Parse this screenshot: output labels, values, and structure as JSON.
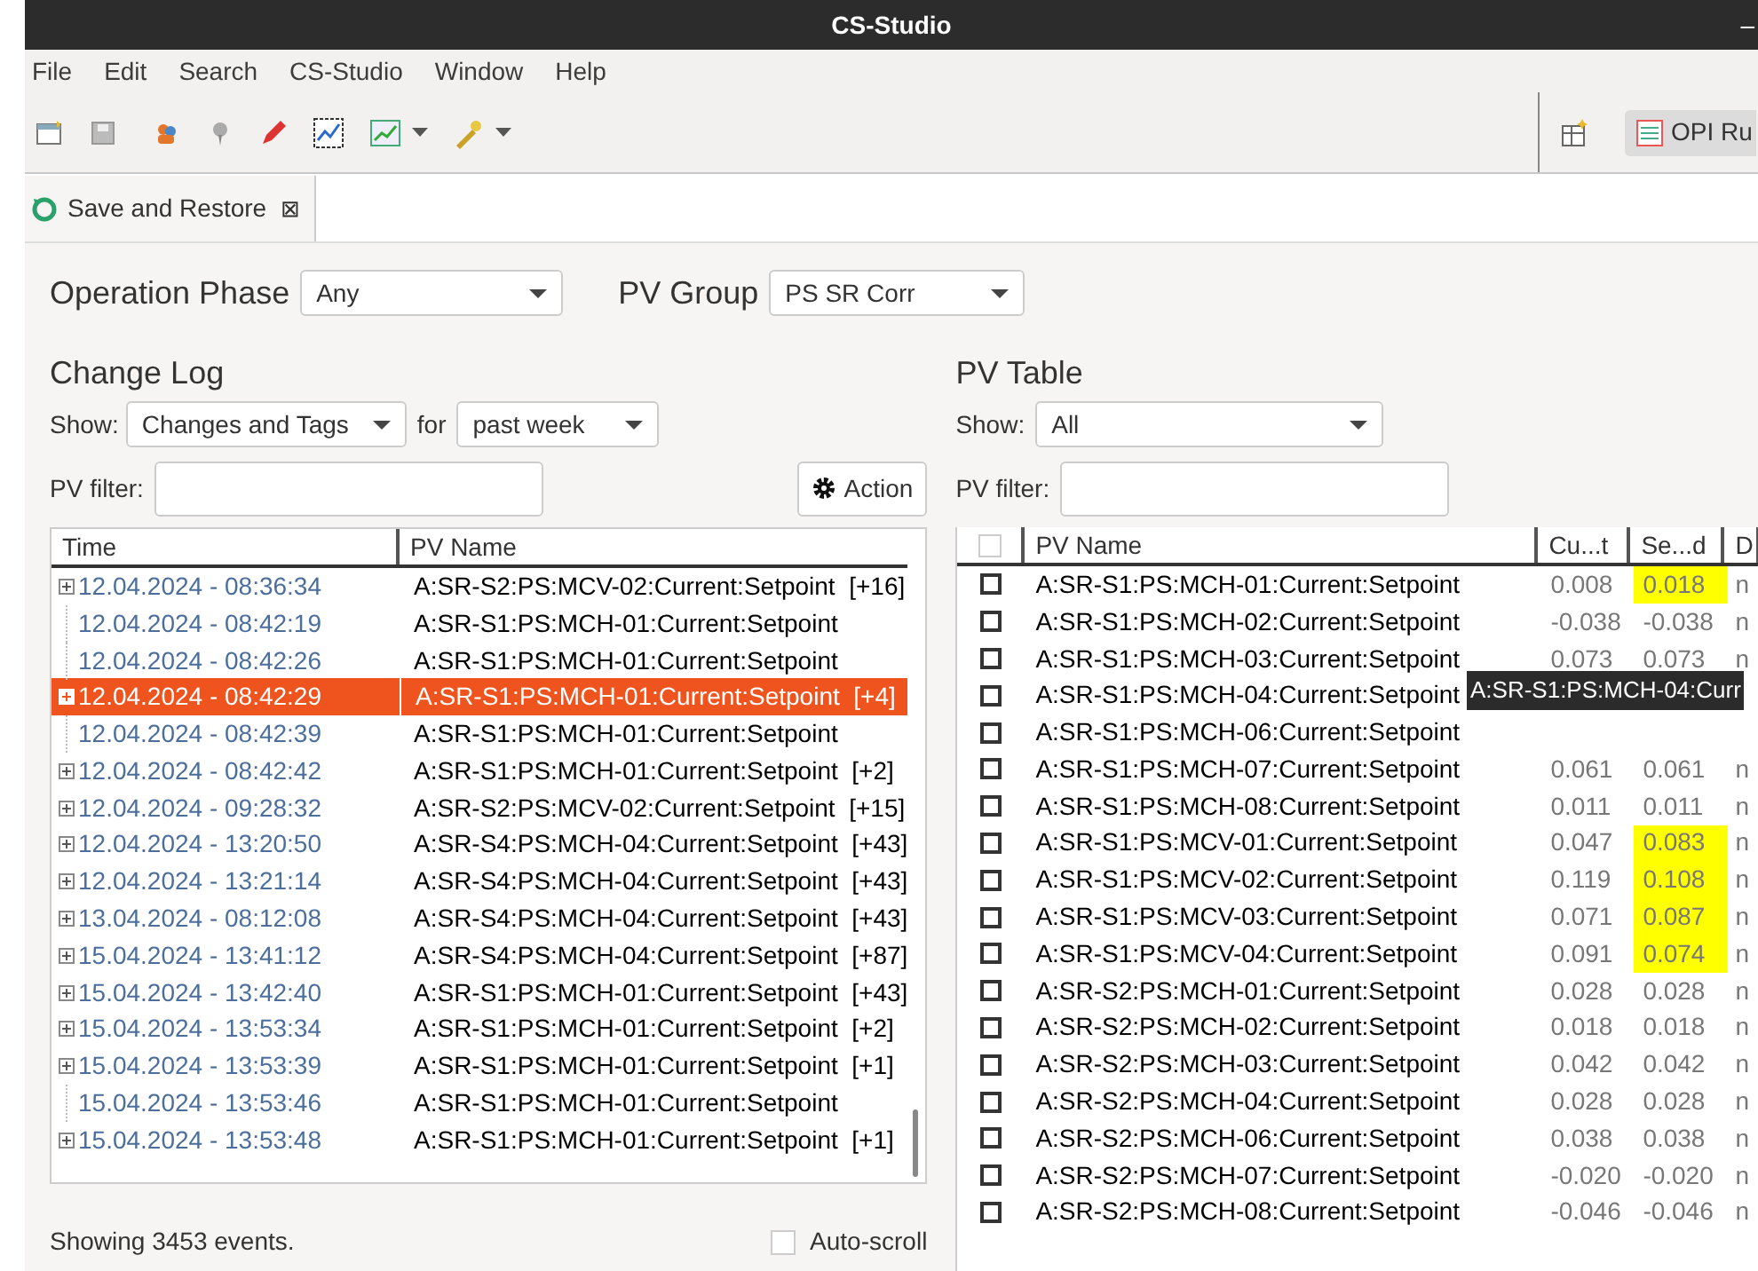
{
  "window": {
    "title": "CS-Studio",
    "control": "–"
  },
  "menu": [
    "File",
    "Edit",
    "Search",
    "CS-Studio",
    "Window",
    "Help"
  ],
  "toolbar": {
    "perspective_button": "OPI Ru"
  },
  "tabs": [
    {
      "label": "Save and Restore",
      "close": "⊠",
      "selected": true
    }
  ],
  "filters": {
    "operation_phase": {
      "label": "Operation Phase",
      "value": "Any"
    },
    "pv_group": {
      "label": "PV Group",
      "value": "PS SR Corr"
    }
  },
  "change_log": {
    "title": "Change Log",
    "show_label": "Show:",
    "show_value": "Changes and Tags",
    "for_label": "for",
    "for_value": "past week",
    "filter_label": "PV filter:",
    "action_button": "Action",
    "columns": [
      "Time",
      "PV Name"
    ],
    "rows": [
      {
        "time": "12.04.2024 - 08:36:34",
        "pv": "A:SR-S2:PS:MCV-02:Current:Setpoint",
        "count": "[+16]",
        "expandable": true,
        "selected": false
      },
      {
        "time": "12.04.2024 - 08:42:19",
        "pv": "A:SR-S1:PS:MCH-01:Current:Setpoint",
        "expandable": false,
        "selected": false
      },
      {
        "time": "12.04.2024 - 08:42:26",
        "pv": "A:SR-S1:PS:MCH-01:Current:Setpoint",
        "expandable": false,
        "selected": false
      },
      {
        "time": "12.04.2024 - 08:42:29",
        "pv": "A:SR-S1:PS:MCH-01:Current:Setpoint",
        "count": "[+4]",
        "expandable": true,
        "selected": true
      },
      {
        "time": "12.04.2024 - 08:42:39",
        "pv": "A:SR-S1:PS:MCH-01:Current:Setpoint",
        "expandable": false,
        "selected": false
      },
      {
        "time": "12.04.2024 - 08:42:42",
        "pv": "A:SR-S1:PS:MCH-01:Current:Setpoint",
        "count": "[+2]",
        "expandable": true,
        "selected": false
      },
      {
        "time": "12.04.2024 - 09:28:32",
        "pv": "A:SR-S2:PS:MCV-02:Current:Setpoint",
        "count": "[+15]",
        "expandable": true,
        "selected": false
      },
      {
        "time": "12.04.2024 - 13:20:50",
        "pv": "A:SR-S4:PS:MCH-04:Current:Setpoint",
        "count": "[+43]",
        "expandable": true,
        "selected": false
      },
      {
        "time": "12.04.2024 - 13:21:14",
        "pv": "A:SR-S4:PS:MCH-04:Current:Setpoint",
        "count": "[+43]",
        "expandable": true,
        "selected": false
      },
      {
        "time": "13.04.2024 - 08:12:08",
        "pv": "A:SR-S4:PS:MCH-04:Current:Setpoint",
        "count": "[+43]",
        "expandable": true,
        "selected": false
      },
      {
        "time": "15.04.2024 - 13:41:12",
        "pv": "A:SR-S4:PS:MCH-04:Current:Setpoint",
        "count": "[+87]",
        "expandable": true,
        "selected": false
      },
      {
        "time": "15.04.2024 - 13:42:40",
        "pv": "A:SR-S1:PS:MCH-01:Current:Setpoint",
        "count": "[+43]",
        "expandable": true,
        "selected": false
      },
      {
        "time": "15.04.2024 - 13:53:34",
        "pv": "A:SR-S1:PS:MCH-01:Current:Setpoint",
        "count": "[+2]",
        "expandable": true,
        "selected": false
      },
      {
        "time": "15.04.2024 - 13:53:39",
        "pv": "A:SR-S1:PS:MCH-01:Current:Setpoint",
        "count": "[+1]",
        "expandable": true,
        "selected": false
      },
      {
        "time": "15.04.2024 - 13:53:46",
        "pv": "A:SR-S1:PS:MCH-01:Current:Setpoint",
        "expandable": false,
        "selected": false
      },
      {
        "time": "15.04.2024 - 13:53:48",
        "pv": "A:SR-S1:PS:MCH-01:Current:Setpoint",
        "count": "[+1]",
        "expandable": true,
        "selected": false
      }
    ],
    "status": "Showing 3453 events.",
    "auto_scroll": {
      "label": "Auto-scroll",
      "checked": false
    }
  },
  "pv_table": {
    "title": "PV Table",
    "show_label": "Show:",
    "show_value": "All",
    "filter_label": "PV filter:",
    "select_all_checked": false,
    "columns": [
      "PV Name",
      "Cu...t",
      "Se...d",
      "D"
    ],
    "rows": [
      {
        "name": "A:SR-S1:PS:MCH-01:Current:Setpoint",
        "current": "0.008",
        "saved": "0.018",
        "changed": true,
        "column_4": "n",
        "checked": false
      },
      {
        "name": "A:SR-S1:PS:MCH-02:Current:Setpoint",
        "current": "-0.038",
        "saved": "-0.038",
        "changed": false,
        "column_4": "n",
        "checked": false
      },
      {
        "name": "A:SR-S1:PS:MCH-03:Current:Setpoint",
        "current": "0.073",
        "saved": "0.073",
        "changed": false,
        "column_4": "n",
        "checked": false
      },
      {
        "name": "A:SR-S1:PS:MCH-04:Current:Setpoint",
        "checked": false
      },
      {
        "name": "A:SR-S1:PS:MCH-06:Current:Setpoint",
        "checked": false
      },
      {
        "name": "A:SR-S1:PS:MCH-07:Current:Setpoint",
        "current": "0.061",
        "saved": "0.061",
        "changed": false,
        "column_4": "n",
        "checked": false
      },
      {
        "name": "A:SR-S1:PS:MCH-08:Current:Setpoint",
        "current": "0.011",
        "saved": "0.011",
        "changed": false,
        "column_4": "n",
        "checked": false
      },
      {
        "name": "A:SR-S1:PS:MCV-01:Current:Setpoint",
        "current": "0.047",
        "saved": "0.083",
        "changed": true,
        "column_4": "n",
        "checked": false
      },
      {
        "name": "A:SR-S1:PS:MCV-02:Current:Setpoint",
        "current": "0.119",
        "saved": "0.108",
        "changed": true,
        "column_4": "n",
        "checked": false
      },
      {
        "name": "A:SR-S1:PS:MCV-03:Current:Setpoint",
        "current": "0.071",
        "saved": "0.087",
        "changed": true,
        "column_4": "n",
        "checked": false
      },
      {
        "name": "A:SR-S1:PS:MCV-04:Current:Setpoint",
        "current": "0.091",
        "saved": "0.074",
        "changed": true,
        "column_4": "n",
        "checked": false
      },
      {
        "name": "A:SR-S2:PS:MCH-01:Current:Setpoint",
        "current": "0.028",
        "saved": "0.028",
        "changed": false,
        "column_4": "n",
        "checked": false
      },
      {
        "name": "A:SR-S2:PS:MCH-02:Current:Setpoint",
        "current": "0.018",
        "saved": "0.018",
        "changed": false,
        "column_4": "n",
        "checked": false
      },
      {
        "name": "A:SR-S2:PS:MCH-03:Current:Setpoint",
        "current": "0.042",
        "saved": "0.042",
        "changed": false,
        "column_4": "n",
        "checked": false
      },
      {
        "name": "A:SR-S2:PS:MCH-04:Current:Setpoint",
        "current": "0.028",
        "saved": "0.028",
        "changed": false,
        "column_4": "n",
        "checked": false
      },
      {
        "name": "A:SR-S2:PS:MCH-06:Current:Setpoint",
        "current": "0.038",
        "saved": "0.038",
        "changed": false,
        "column_4": "n",
        "checked": false
      },
      {
        "name": "A:SR-S2:PS:MCH-07:Current:Setpoint",
        "current": "-0.020",
        "saved": "-0.020",
        "changed": false,
        "column_4": "n",
        "checked": false
      },
      {
        "name": "A:SR-S2:PS:MCH-08:Current:Setpoint",
        "current": "-0.046",
        "saved": "-0.046",
        "changed": false,
        "column_4": "n",
        "checked": false
      }
    ],
    "tooltip": "A:SR-S1:PS:MCH-04:Curr"
  }
}
